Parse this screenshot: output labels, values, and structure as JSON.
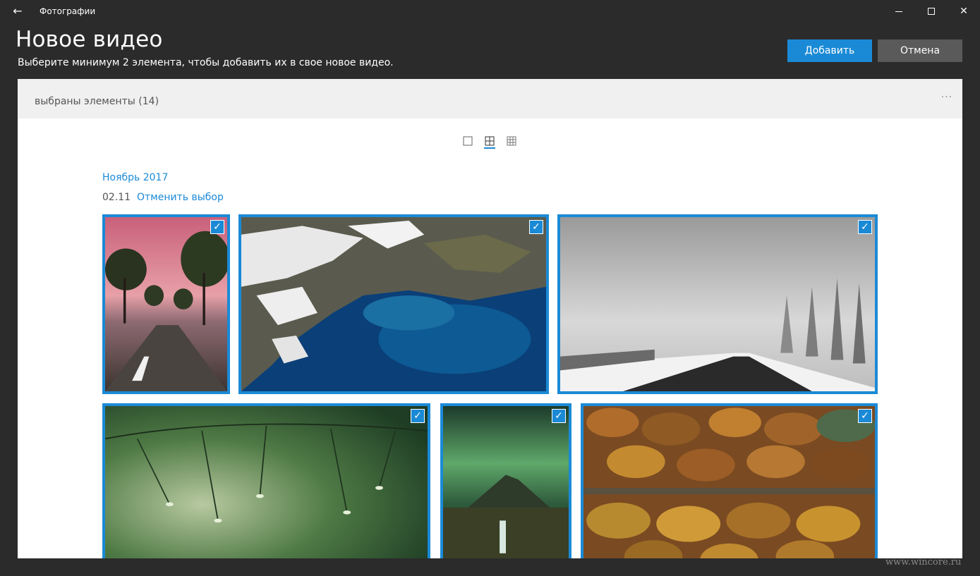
{
  "window": {
    "app_title": "Фотографии",
    "back_icon": "back-arrow-icon",
    "controls": [
      "minimize",
      "maximize",
      "close"
    ]
  },
  "header": {
    "title": "Новое видео",
    "subtitle": "Выберите минимум 2 элемента, чтобы добавить их в свое новое видео.",
    "add_label": "Добавить",
    "cancel_label": "Отмена"
  },
  "panel": {
    "selected_label": "выбраны элементы (14)",
    "more_label": "···",
    "view_modes": [
      "single",
      "medium",
      "small"
    ],
    "active_view": "medium"
  },
  "gallery": {
    "month": "Ноябрь 2017",
    "date": "02.11",
    "deselect_label": "Отменить выбор",
    "photos": [
      {
        "subject": "tree-lined road at pink sunset",
        "selected": true
      },
      {
        "subject": "aerial snowy coast with blue water",
        "selected": true
      },
      {
        "subject": "misty snowy road with trees",
        "selected": true
      },
      {
        "subject": "pine branches with raindrops",
        "selected": true
      },
      {
        "subject": "aurora over mountain and waterfall",
        "selected": true
      },
      {
        "subject": "aerial autumn forest with road",
        "selected": true
      }
    ]
  },
  "colors": {
    "accent": "#1b8ad6",
    "background": "#2b2b2b",
    "panel": "#ffffff",
    "panel_header": "#f0f0f0",
    "cancel_button": "#5a5a5a"
  },
  "watermark": "www.wincore.ru"
}
